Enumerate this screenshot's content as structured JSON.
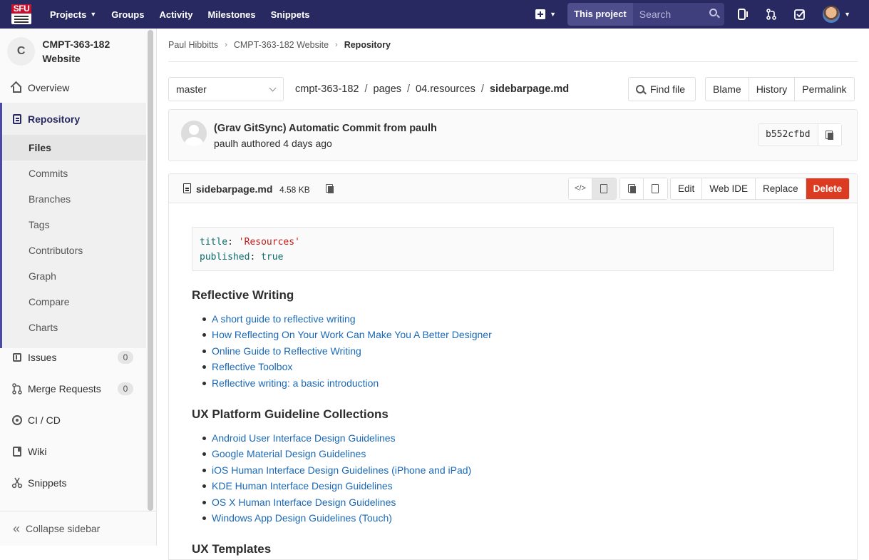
{
  "nav": {
    "logo_text": "SFU",
    "links": [
      {
        "label": "Projects",
        "caret": true
      },
      {
        "label": "Groups"
      },
      {
        "label": "Activity"
      },
      {
        "label": "Milestones"
      },
      {
        "label": "Snippets"
      }
    ],
    "search_scope": "This project",
    "search_placeholder": "Search"
  },
  "sidebar": {
    "project_initial": "C",
    "project_name": "CMPT-363-182 Website",
    "overview": "Overview",
    "repository": "Repository",
    "repo_items": [
      "Files",
      "Commits",
      "Branches",
      "Tags",
      "Contributors",
      "Graph",
      "Compare",
      "Charts"
    ],
    "issues": {
      "label": "Issues",
      "count": "0"
    },
    "merge_requests": {
      "label": "Merge Requests",
      "count": "0"
    },
    "cicd": "CI / CD",
    "wiki": "Wiki",
    "snippets": "Snippets",
    "collapse": "Collapse sidebar"
  },
  "breadcrumb": {
    "items": [
      "Paul Hibbitts",
      "CMPT-363-182 Website"
    ],
    "current": "Repository"
  },
  "tree": {
    "branch": "master",
    "path": [
      "cmpt-363-182",
      "pages",
      "04.resources"
    ],
    "file": "sidebarpage.md",
    "find_file": "Find file",
    "buttons": [
      "Blame",
      "History",
      "Permalink"
    ]
  },
  "commit": {
    "title": "(Grav GitSync) Automatic Commit from paulh",
    "meta": "paulh authored 4 days ago",
    "sha": "b552cfbd"
  },
  "file": {
    "name": "sidebarpage.md",
    "size": "4.58 KB",
    "source_glyph": "</>",
    "actions": [
      "Edit",
      "Web IDE",
      "Replace"
    ],
    "delete": "Delete"
  },
  "frontmatter": {
    "title_key": "title",
    "title_val": "'Resources'",
    "published_key": "published",
    "published_val": "true"
  },
  "content": {
    "sections": [
      {
        "heading": "Reflective Writing",
        "links": [
          "A short guide to reflective writing",
          "How Reflecting On Your Work Can Make You A Better Designer",
          "Online Guide to Reflective Writing",
          "Reflective Toolbox",
          "Reflective writing: a basic introduction"
        ]
      },
      {
        "heading": "UX Platform Guideline Collections",
        "links": [
          "Android User Interface Design Guidelines",
          "Google Material Design Guidelines",
          "iOS Human Interface Design Guidelines (iPhone and iPad)",
          "KDE Human Interface Design Guidelines",
          "OS X Human Interface Design Guidelines",
          "Windows App Design Guidelines (Touch)"
        ]
      },
      {
        "heading": "UX Templates",
        "links": []
      }
    ]
  },
  "colors": {
    "nav_bg": "#292961",
    "link": "#1b69b6",
    "delete": "#db3b21",
    "sidebar_accent": "#4b4ba3"
  }
}
